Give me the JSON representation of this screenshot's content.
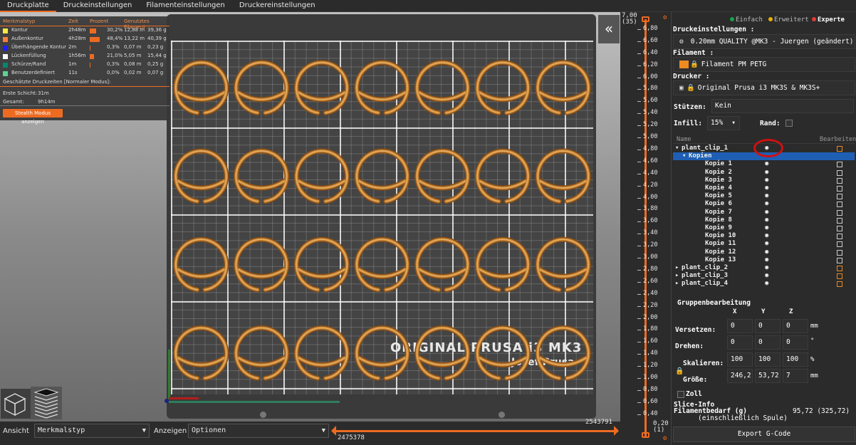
{
  "tabs": [
    "Druckplatte",
    "Druckeinstellungen",
    "Filamenteinstellungen",
    "Druckereinstellungen"
  ],
  "legend": {
    "headers": {
      "type": "Merkmalstyp",
      "time": "Zeit",
      "percent": "Prozent",
      "filament": "Genutztes Filament"
    },
    "rows": [
      {
        "name": "Kontur",
        "time": "2h48m",
        "percent": "30,2%",
        "pct": 30.2,
        "length": "12,88 m",
        "weight": "39,36 g",
        "color": "#ffe640"
      },
      {
        "name": "Außenkontur",
        "time": "4h28m",
        "percent": "48,4%",
        "pct": 48.4,
        "length": "13,22 m",
        "weight": "40,39 g",
        "color": "#ff7d38"
      },
      {
        "name": "Überhängende Kontur",
        "time": "2m",
        "percent": "0,3%",
        "pct": 0.3,
        "length": "0,07 m",
        "weight": "0,23 g",
        "color": "#1f1fff"
      },
      {
        "name": "Lückenfüllung",
        "time": "1h56m",
        "percent": "21,0%",
        "pct": 21.0,
        "length": "5,05 m",
        "weight": "15,44 g",
        "color": "#ffffff"
      },
      {
        "name": "Schürze/Rand",
        "time": "1m",
        "percent": "0,3%",
        "pct": 0.3,
        "length": "0,08 m",
        "weight": "0,25 g",
        "color": "#00876e"
      },
      {
        "name": "Benutzerdefiniert",
        "time": "11s",
        "percent": "0,0%",
        "pct": 0.0,
        "length": "0,02 m",
        "weight": "0,07 g",
        "color": "#5ed194"
      }
    ],
    "estimate_title": "Geschätzte Druckzeiten [Normaler Modus]:",
    "first_layer_label": "Erste Schicht:",
    "first_layer_value": "31m",
    "total_label": "Gesamt:",
    "total_value": "9h14m",
    "stealth_button": "Stealth Modus anzeigen"
  },
  "bed": {
    "logo_line1": "ORIGINAL PRUSA i3 MK3",
    "logo_line2": "Josef Prusa"
  },
  "toolbar": {
    "view_label": "Ansicht",
    "view_value": "Merkmalstyp",
    "show_label": "Anzeigen",
    "show_value": "Optionen",
    "slider_min": "2475378",
    "slider_max": "2543791"
  },
  "layers": {
    "top_value": "7,00",
    "top_index": "(35)",
    "bottom_value": "0,20",
    "bottom_index": "(1)",
    "ticks": [
      "7,00",
      "6,80",
      "6,60",
      "6,40",
      "6,20",
      "6,00",
      "5,80",
      "5,60",
      "5,40",
      "5,20",
      "5,00",
      "4,80",
      "4,60",
      "4,40",
      "4,20",
      "4,00",
      "3,80",
      "3,60",
      "3,40",
      "3,20",
      "3,00",
      "2,80",
      "2,60",
      "2,40",
      "2,20",
      "2,00",
      "1,80",
      "1,60",
      "1,40",
      "1,20",
      "1,00",
      "0,80",
      "0,60",
      "0,40"
    ]
  },
  "modes": {
    "simple": "Einfach",
    "advanced": "Erweitert",
    "expert": "Experte"
  },
  "print_settings": {
    "label": "Druckeinstellungen :",
    "value": "0.20mm QUALITY @MK3 - Juergen (geändert)"
  },
  "filament": {
    "label": "Filament :",
    "value": "Filament PM PETG"
  },
  "printer": {
    "label": "Drucker :",
    "value": "Original Prusa i3 MK3S & MK3S+"
  },
  "supports": {
    "label": "Stützen:",
    "value": "Kein"
  },
  "infill": {
    "label": "Infill:",
    "value": "15%",
    "brim_label": "Rand:"
  },
  "object_list": {
    "col_name": "Name",
    "col_edit": "Bearbeiten",
    "items": [
      {
        "name": "plant_clip_1",
        "indent": 0,
        "arrow": "▾",
        "selected": false,
        "edit": "orange"
      },
      {
        "name": "Kopien",
        "indent": 1,
        "arrow": "▾",
        "selected": true,
        "edit": ""
      },
      {
        "name": "Kopie 1",
        "indent": 2,
        "arrow": "",
        "selected": false,
        "edit": "grid"
      },
      {
        "name": "Kopie 2",
        "indent": 2,
        "arrow": "",
        "selected": false,
        "edit": "grid"
      },
      {
        "name": "Kopie 3",
        "indent": 2,
        "arrow": "",
        "selected": false,
        "edit": "grid"
      },
      {
        "name": "Kopie 4",
        "indent": 2,
        "arrow": "",
        "selected": false,
        "edit": "grid"
      },
      {
        "name": "Kopie 5",
        "indent": 2,
        "arrow": "",
        "selected": false,
        "edit": "grid"
      },
      {
        "name": "Kopie 6",
        "indent": 2,
        "arrow": "",
        "selected": false,
        "edit": "grid"
      },
      {
        "name": "Kopie 7",
        "indent": 2,
        "arrow": "",
        "selected": false,
        "edit": "grid"
      },
      {
        "name": "Kopie 8",
        "indent": 2,
        "arrow": "",
        "selected": false,
        "edit": "grid"
      },
      {
        "name": "Kopie 9",
        "indent": 2,
        "arrow": "",
        "selected": false,
        "edit": "grid"
      },
      {
        "name": "Kopie 10",
        "indent": 2,
        "arrow": "",
        "selected": false,
        "edit": "grid"
      },
      {
        "name": "Kopie 11",
        "indent": 2,
        "arrow": "",
        "selected": false,
        "edit": "grid"
      },
      {
        "name": "Kopie 12",
        "indent": 2,
        "arrow": "",
        "selected": false,
        "edit": "grid"
      },
      {
        "name": "Kopie 13",
        "indent": 2,
        "arrow": "",
        "selected": false,
        "edit": "grid"
      },
      {
        "name": "plant_clip_2",
        "indent": 0,
        "arrow": "▸",
        "selected": false,
        "edit": "orange"
      },
      {
        "name": "plant_clip_3",
        "indent": 0,
        "arrow": "▸",
        "selected": false,
        "edit": "orange"
      },
      {
        "name": "plant_clip_4",
        "indent": 0,
        "arrow": "▸",
        "selected": false,
        "edit": "orange"
      }
    ]
  },
  "group_edit": {
    "title": "Gruppenbearbeitung",
    "axes": [
      "X",
      "Y",
      "Z"
    ],
    "position_label": "Versetzen:",
    "position": [
      "0",
      "0",
      "0"
    ],
    "position_unit": "mm",
    "rotation_label": "Drehen:",
    "rotation": [
      "0",
      "0",
      "0"
    ],
    "rotation_unit": "°",
    "scale_label": "Skalieren:",
    "scale": [
      "100",
      "100",
      "100"
    ],
    "scale_unit": "%",
    "size_label": "Größe:",
    "size": [
      "246,2",
      "53,72",
      "7"
    ],
    "size_unit": "mm",
    "inch_label": "Zoll"
  },
  "slice_info": {
    "title": "Slice-Info",
    "filament_label": "Filamentbedarf (g)",
    "filament_sublabel": "(einschließlich Spule)",
    "filament_value": "95,72 (325,72)"
  },
  "export_button": "Export G-Code",
  "colors": {
    "accent": "#ed6b21",
    "selection": "#1e5fb4",
    "part": "#c98a3a",
    "highlight_ring": "#d01010"
  }
}
